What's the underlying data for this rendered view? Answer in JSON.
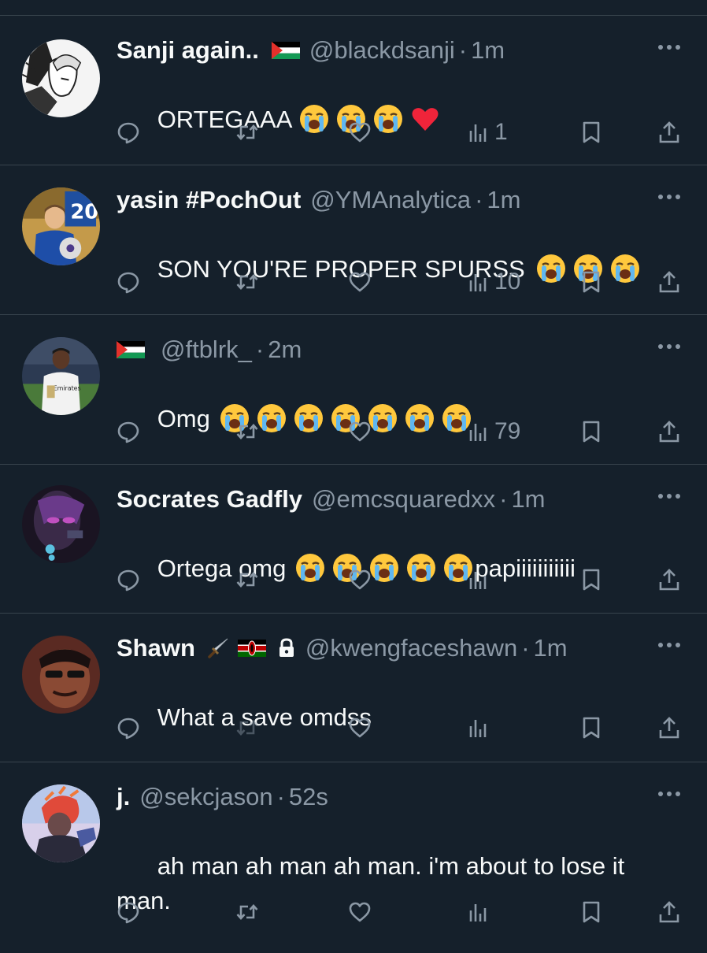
{
  "colors": {
    "background": "#15202b",
    "divider": "#38444d",
    "secondary_text": "#8b98a5",
    "primary_text": "#f7f9f9"
  },
  "tweets": [
    {
      "name": "Sanji again..",
      "flags": [
        "palestine-flag"
      ],
      "handle": "@blackdsanji",
      "time": "1m",
      "text": "ORTEGAAA",
      "emoji": [
        "loudly-crying-face",
        "loudly-crying-face",
        "loudly-crying-face",
        "red-heart"
      ],
      "views": "1"
    },
    {
      "name": "yasin #PochOut",
      "handle": "@YMAnalytica",
      "time": "1m",
      "text": "SON YOU'RE PROPER SPURSS",
      "emoji": [
        "loudly-crying-face",
        "loudly-crying-face",
        "loudly-crying-face"
      ],
      "views": "10"
    },
    {
      "name": "",
      "flags": [
        "palestine-flag"
      ],
      "handle": "@ftblrk_",
      "time": "2m",
      "text": "Omg",
      "emoji": [
        "loudly-crying-face",
        "loudly-crying-face",
        "loudly-crying-face",
        "loudly-crying-face",
        "loudly-crying-face",
        "loudly-crying-face",
        "loudly-crying-face"
      ],
      "views": "79"
    },
    {
      "name": "Socrates Gadfly",
      "handle": "@emcsquaredxx",
      "time": "1m",
      "text": "Ortega omg",
      "emoji": [
        "loudly-crying-face",
        "loudly-crying-face",
        "loudly-crying-face",
        "loudly-crying-face",
        "loudly-crying-face"
      ],
      "text_after": "papiiiiiiiiiii",
      "views": ""
    },
    {
      "name": "Shawn",
      "flags": [
        "dagger-emoji",
        "kenya-flag"
      ],
      "protected": true,
      "handle": "@kwengfaceshawn",
      "time": "1m",
      "text": "What a save omdss",
      "views": "",
      "retweet_disabled": true
    },
    {
      "name": "j.",
      "handle": "@sekcjason",
      "time": "52s",
      "text": "ah man ah man ah man. i'm about to lose it man.",
      "views": ""
    }
  ]
}
